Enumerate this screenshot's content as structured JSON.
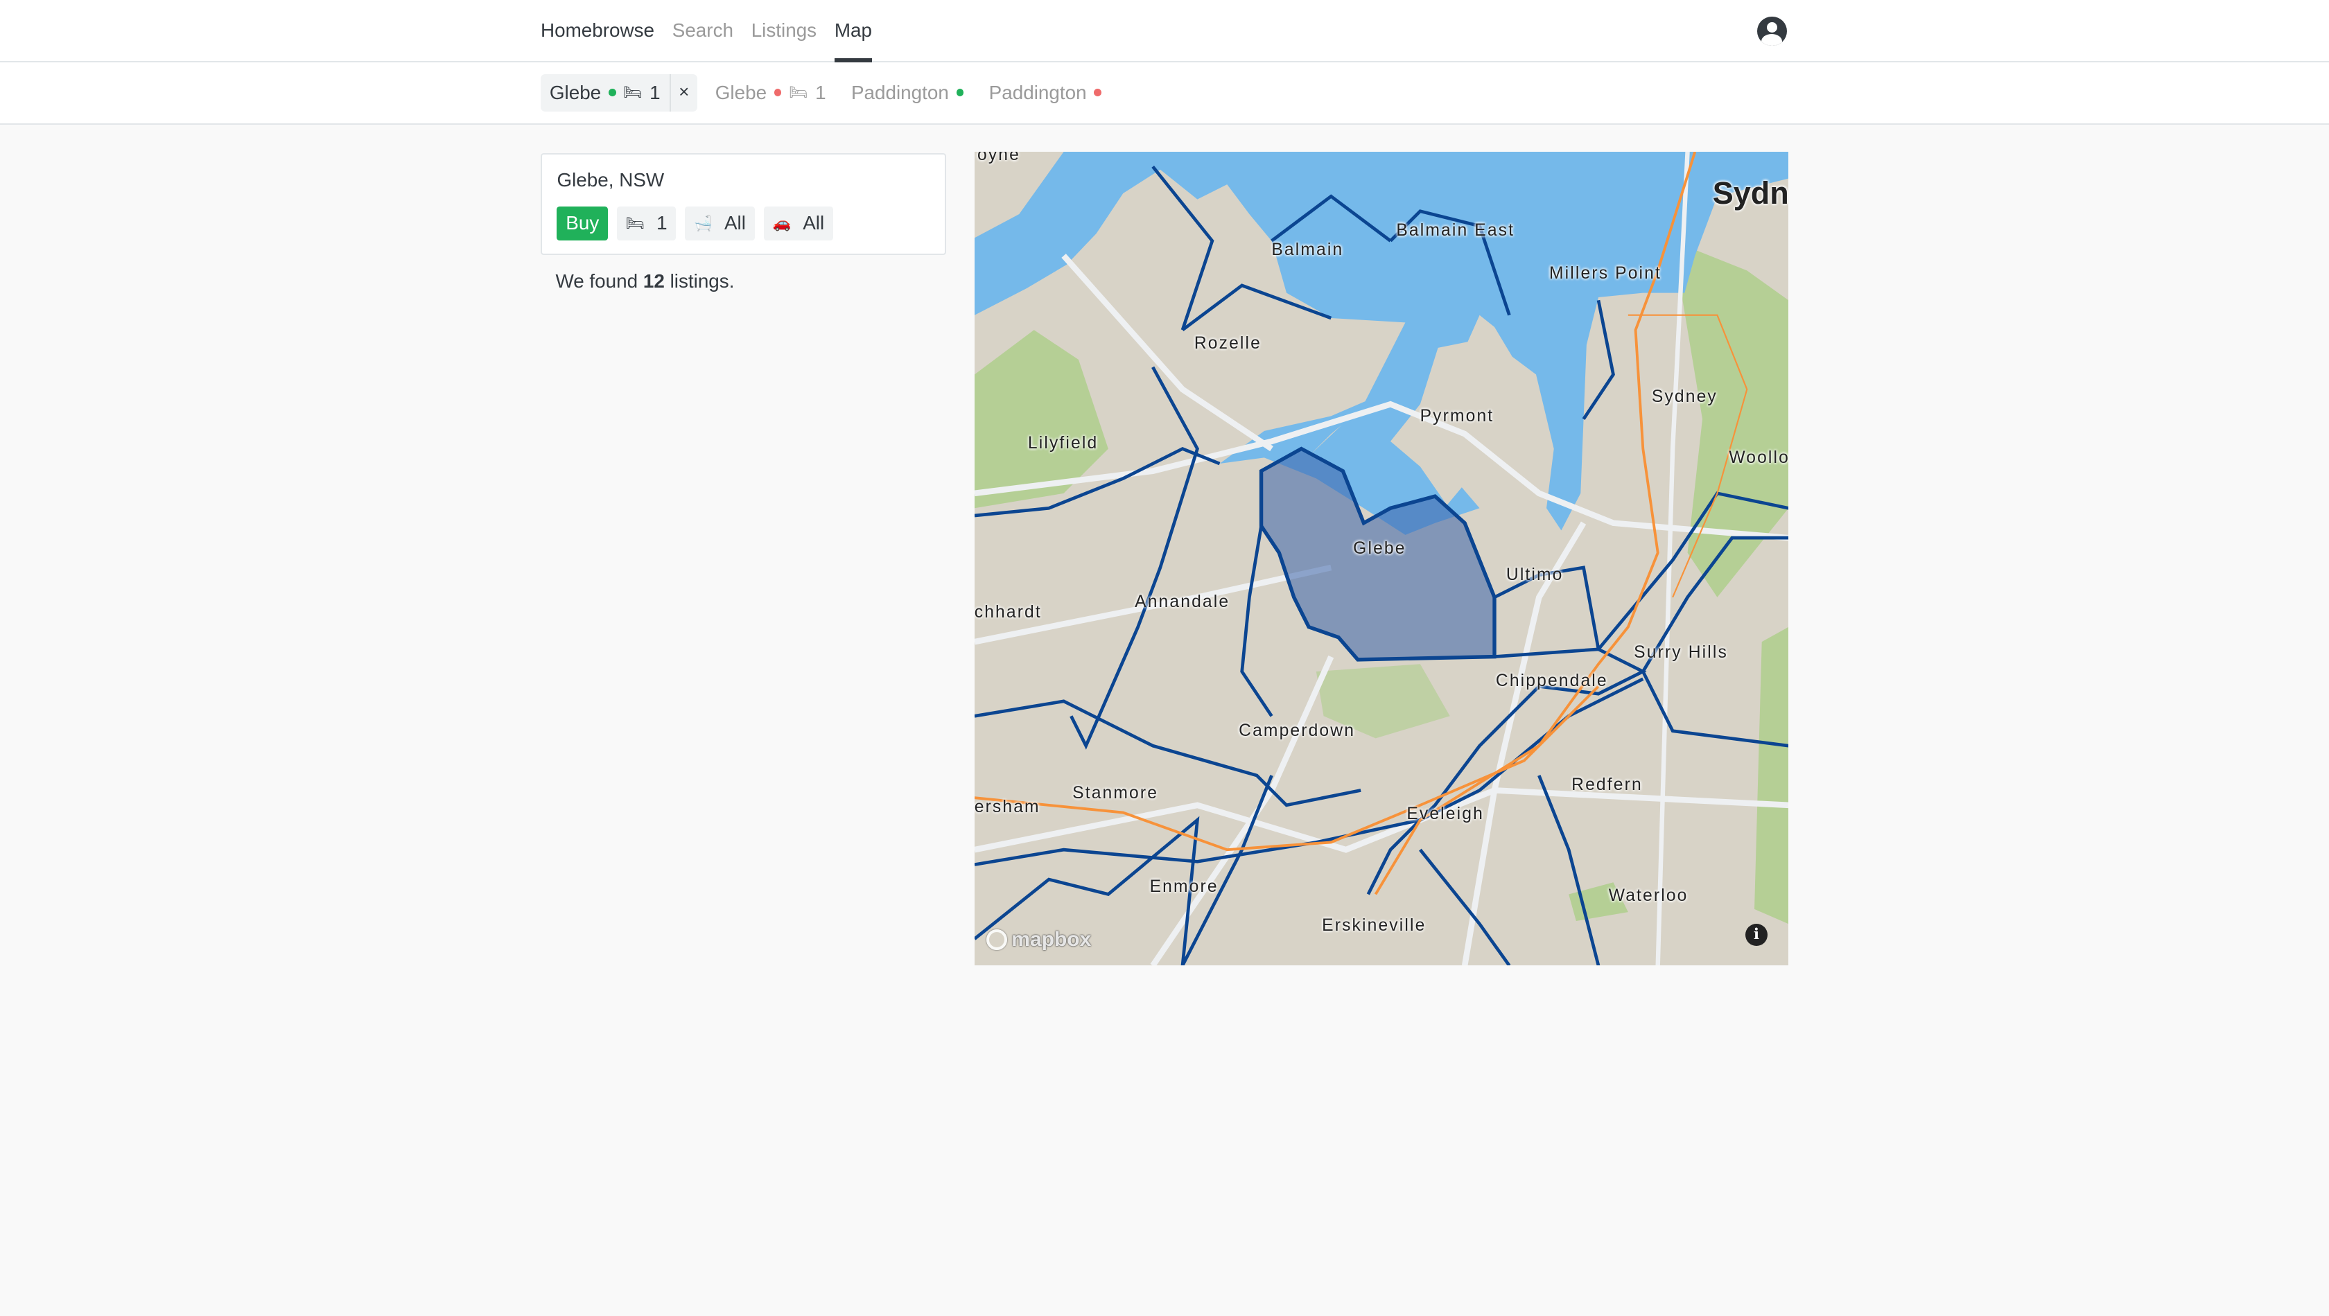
{
  "nav": {
    "brand": "Homebrowse",
    "links": [
      "Search",
      "Listings"
    ],
    "active": "Map"
  },
  "tabs": [
    {
      "label": "Glebe",
      "status_color": "#20b15a",
      "icon": "bed-icon",
      "icon_glyph": "🛏",
      "beds": "1",
      "selected": true,
      "close": "×"
    },
    {
      "label": "Glebe",
      "status_color": "#ef6b6b",
      "icon": "bed-icon",
      "icon_glyph": "🛏",
      "beds": "1"
    },
    {
      "label": "Paddington",
      "status_color": "#20b15a"
    },
    {
      "label": "Paddington",
      "status_color": "#ef6b6b"
    }
  ],
  "search_card": {
    "location": "Glebe, NSW",
    "filters": {
      "mode": "Buy",
      "beds_icon": "🛏",
      "beds": "1",
      "baths_icon": "🛁",
      "baths": "All",
      "cars_icon": "🚗",
      "cars": "All"
    }
  },
  "results": {
    "prefix": "We found",
    "count": "12",
    "suffix": "listings."
  },
  "map": {
    "highlighted_suburb": "Glebe",
    "labels": [
      "oyne",
      "Balmain",
      "Balmain East",
      "Sydn",
      "Millers Point",
      "Rozelle",
      "Sydney",
      "Pyrmont",
      "Lilyfield",
      "Woollo",
      "Glebe",
      "Ultimo",
      "chhardt",
      "Annandale",
      "Surry Hills",
      "Chippendale",
      "Camperdown",
      "Redfern",
      "Stanmore",
      "ersham",
      "Eveleigh",
      "Enmore",
      "Waterloo",
      "Erskineville"
    ],
    "attribution": "mapbox",
    "info": "i",
    "colors": {
      "water": "#75b9ea",
      "land": "#d8d3c7",
      "park": "#b5cf95",
      "boundary": "#0b4591",
      "highlight": "#3c64aa",
      "rail": "#f7923a"
    }
  }
}
